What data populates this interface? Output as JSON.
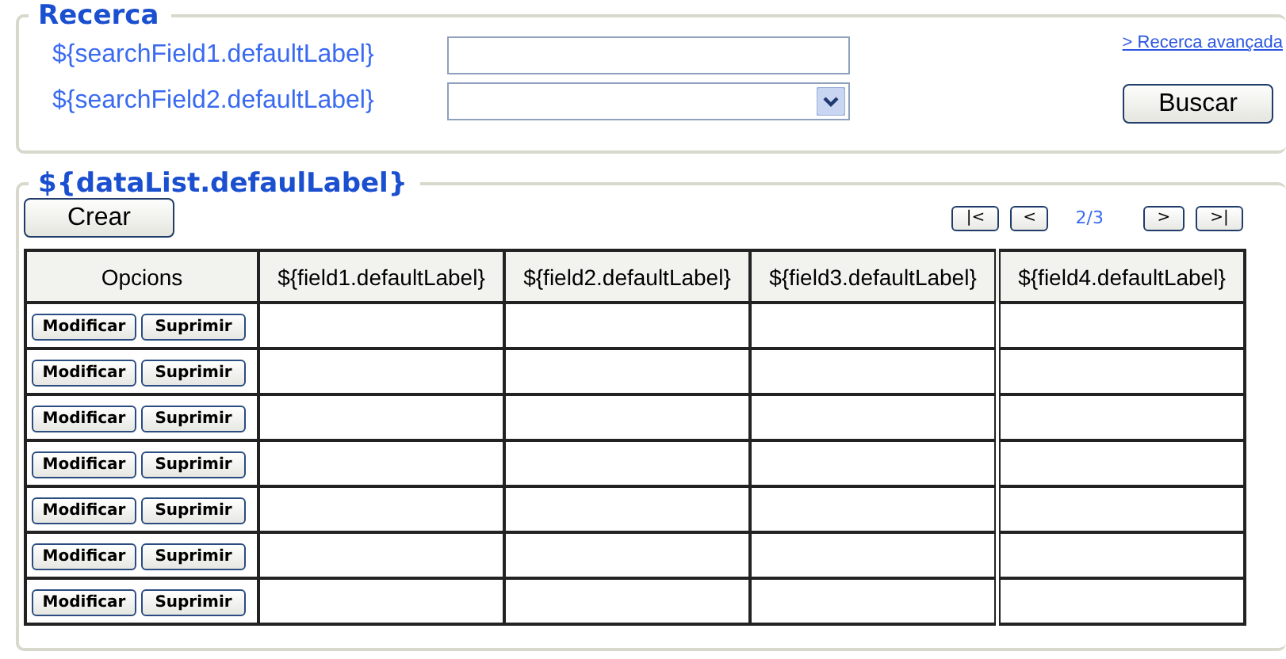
{
  "search": {
    "legend": "Recerca",
    "fields": [
      {
        "label": "${searchField1.defaultLabel}",
        "kind": "text"
      },
      {
        "label": "${searchField2.defaultLabel}",
        "kind": "select"
      }
    ],
    "advanced_link": "> Recerca avançada",
    "search_button": "Buscar"
  },
  "data_list": {
    "legend": "${dataList.defaulLabel}",
    "create_button": "Crear",
    "pager": {
      "first": "|<",
      "prev": "<",
      "page": "2/3",
      "next": ">",
      "last": ">|"
    },
    "columns": [
      "Opcions",
      "${field1.defaultLabel}",
      "${field2.defaultLabel}",
      "${field3.defaultLabel}",
      "${field4.defaultLabel}"
    ],
    "rows": [
      {
        "actions": [
          "Modificar",
          "Suprimir"
        ]
      },
      {
        "actions": [
          "Modificar",
          "Suprimir"
        ]
      },
      {
        "actions": [
          "Modificar",
          "Suprimir"
        ]
      },
      {
        "actions": [
          "Modificar",
          "Suprimir"
        ]
      },
      {
        "actions": [
          "Modificar",
          "Suprimir"
        ]
      },
      {
        "actions": [
          "Modificar",
          "Suprimir"
        ]
      },
      {
        "actions": [
          "Modificar",
          "Suprimir"
        ]
      }
    ]
  }
}
